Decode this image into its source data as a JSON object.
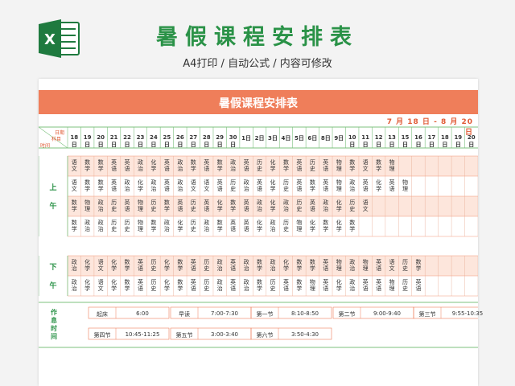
{
  "header": {
    "title": "暑假课程安排表",
    "subtitle": "A4打印 / 自动公式 / 内容可修改",
    "logo_icon": "excel-icon"
  },
  "sheet": {
    "banner_title": "暑假课程安排表",
    "date_range": "7 月 18 日 - 8 月 20 日",
    "corner": {
      "date": "日期",
      "subject": "科目",
      "time": "时间"
    },
    "dates": [
      "18日",
      "19日",
      "20日",
      "21日",
      "22日",
      "23日",
      "24日",
      "25日",
      "26日",
      "27日",
      "28日",
      "29日",
      "30日",
      "1日",
      "2日",
      "3日",
      "4日",
      "5日",
      "6日",
      "8日",
      "9日",
      "10日",
      "11日",
      "12日",
      "13日",
      "15日",
      "16日",
      "17日",
      "18日",
      "19日",
      "20日"
    ],
    "periods": {
      "morning": "上\n\n午",
      "afternoon": "下\n\n午"
    },
    "morning_rows": [
      [
        "语文",
        "数学",
        "数学",
        "英语",
        "英语",
        "政治",
        "化学",
        "英语",
        "政治",
        "数学",
        "英语",
        "数学",
        "政治",
        "英语",
        "历史",
        "化学",
        "数学",
        "英语",
        "历史",
        "英语",
        "物理",
        "数学",
        "语文",
        "数学",
        "物理"
      ],
      [
        "语文",
        "数学",
        "数学",
        "英语",
        "政治",
        "化学",
        "政治",
        "英语",
        "政治",
        "语文",
        "语文",
        "英语",
        "历史",
        "政治",
        "英语",
        "化学",
        "历史",
        "英语",
        "数学",
        "英语",
        "物理",
        "政治",
        "英语",
        "化学",
        "英语",
        "物理"
      ],
      [
        "数学",
        "物理",
        "政治",
        "历史",
        "英语",
        "物理",
        "历史",
        "数学",
        "英语",
        "历史",
        "英语",
        "化学",
        "数学",
        "英语",
        "政治",
        "化学",
        "政治",
        "历史",
        "英语",
        "政治",
        "化学",
        "历史",
        "语文"
      ],
      [
        "数学",
        "政治",
        "政治",
        "历史",
        "历史",
        "物理",
        "数学",
        "政治",
        "化学",
        "历史",
        "政治",
        "数学",
        "英语",
        "英语",
        "化学",
        "政治",
        "历史",
        "物理",
        "化学",
        "数学",
        "化学",
        "数学"
      ]
    ],
    "afternoon_rows": [
      [
        "政治",
        "化学",
        "语文",
        "化学",
        "数学",
        "英语",
        "历史",
        "化学",
        "数学",
        "英语",
        "历史",
        "政治",
        "英语",
        "政治",
        "数学",
        "政治",
        "化学",
        "数学",
        "数学",
        "英语",
        "物理",
        "政治",
        "物理",
        "英语",
        "语文",
        "历史",
        "数学"
      ],
      [
        "政治",
        "化学",
        "语文",
        "化学",
        "数学",
        "英语",
        "历史",
        "化学",
        "数学",
        "英语",
        "历史",
        "政治",
        "英语",
        "政治",
        "数学",
        "历史",
        "英语",
        "数学",
        "物理",
        "英语",
        "化学",
        "政治",
        "英语",
        "英语",
        "物理",
        "历史",
        "英语"
      ]
    ],
    "rest": {
      "label": "作\n息\n时\n间",
      "items": [
        {
          "name": "起床",
          "time": "6:00"
        },
        {
          "name": "早读",
          "time": "7:00-7:30"
        },
        {
          "name": "第一节",
          "time": "8:10-8:50"
        },
        {
          "name": "第二节",
          "time": "9:00-9:40"
        },
        {
          "name": "第三节",
          "time": "9:55-10:35"
        },
        {
          "name": "第四节",
          "time": "10:45-11:25"
        },
        {
          "name": "第五节",
          "time": "3:00-3:40"
        },
        {
          "name": "第六节",
          "time": "3:50-4:30"
        }
      ]
    },
    "colors": {
      "accent": "#ef7e5a",
      "green": "#2a9247",
      "row_tint": "#fde6dc",
      "line": "#7cc07e"
    }
  }
}
